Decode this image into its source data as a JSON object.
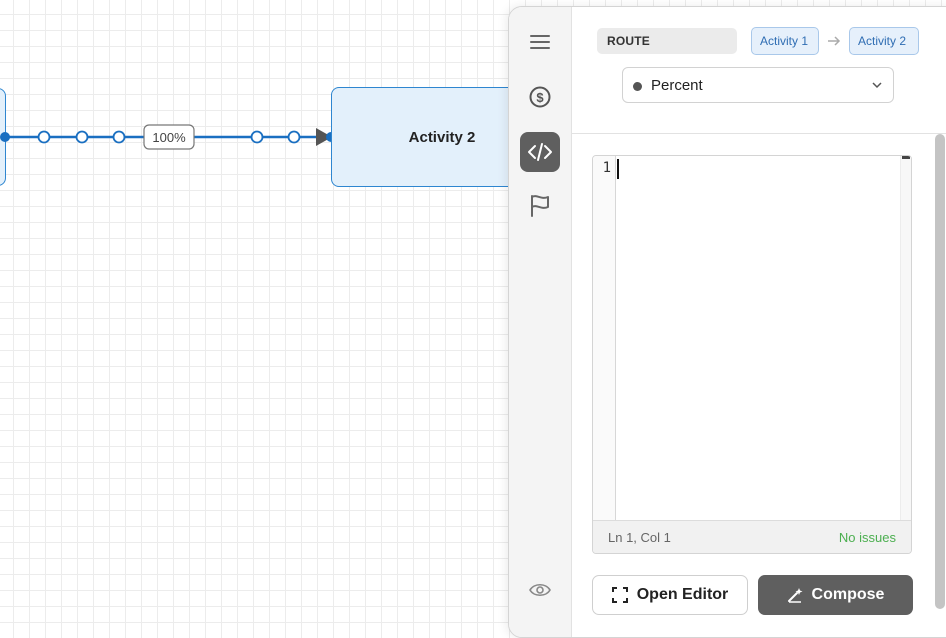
{
  "flow": {
    "left_node_label": "",
    "right_node_label": "Activity 2",
    "edge_label": "100%"
  },
  "sidebar": {
    "items": [
      {
        "name": "menu-icon",
        "active": false
      },
      {
        "name": "dollar-circle-icon",
        "active": false
      },
      {
        "name": "code-icon",
        "active": true
      },
      {
        "name": "flag-icon",
        "active": false
      }
    ],
    "bottom_icon": "eye-icon"
  },
  "panel": {
    "route_label": "ROUTE",
    "route_from": "Activity 1",
    "route_to": "Activity 2",
    "select": {
      "value": "Percent",
      "dot_color": "#555555"
    }
  },
  "editor": {
    "line_numbers": "1",
    "content": "",
    "status_position": "Ln 1, Col 1",
    "status_issues": "No issues"
  },
  "actions": {
    "open_editor_label": "Open Editor",
    "compose_label": "Compose"
  },
  "colors": {
    "edge": "#1a6fc1",
    "node_fill": "#e3f0fb",
    "node_border": "#2e86d0",
    "crumb_text": "#2f6db3",
    "success": "#4caf50",
    "dark_button": "#5f5f5f"
  }
}
